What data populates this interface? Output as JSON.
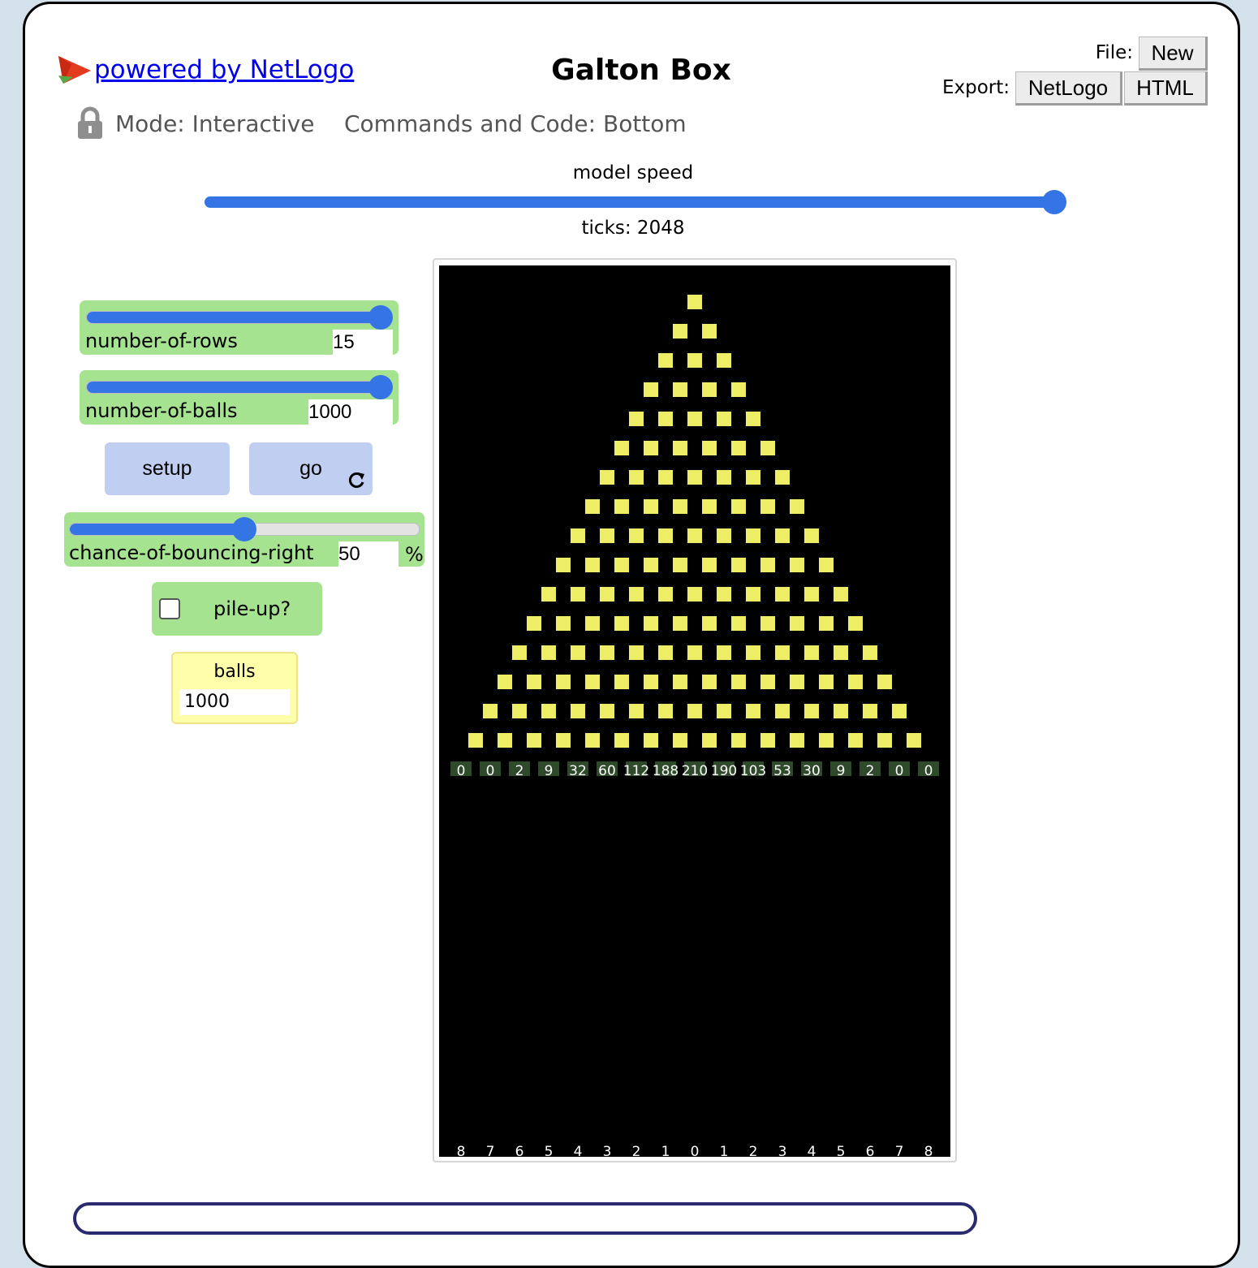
{
  "header": {
    "powered_by": "powered by NetLogo",
    "title": "Galton Box",
    "file_label": "File:",
    "new_label": "New",
    "export_label": "Export:",
    "export_netlogo_label": "NetLogo",
    "export_html_label": "HTML"
  },
  "mode": {
    "lock_icon": "lock-icon",
    "mode_text": "Mode: Interactive",
    "commands_text": "Commands and Code: Bottom"
  },
  "speed": {
    "label": "model speed",
    "value": 1.0,
    "ticks_text": "ticks: 2048"
  },
  "widgets": {
    "rows": {
      "label": "number-of-rows",
      "value": "15",
      "fill": 1.0
    },
    "balls": {
      "label": "number-of-balls",
      "value": "1000",
      "fill": 1.0
    },
    "setup_label": "setup",
    "go_label": "go",
    "go_icon": "forever-icon",
    "bounce": {
      "label": "chance-of-bouncing-right",
      "value": "50",
      "units": "%",
      "fill": 0.5
    },
    "pileup": {
      "label": "pile-up?",
      "checked": false
    },
    "monitor": {
      "label": "balls",
      "value": "1000"
    }
  },
  "view": {
    "peg_rows": 16,
    "peg_color": "#eeee66",
    "bin_counts": [
      "0",
      "0",
      "2",
      "9",
      "32",
      "60",
      "112",
      "188",
      "210",
      "190",
      "103",
      "53",
      "30",
      "9",
      "2",
      "0",
      "0"
    ],
    "bin_labels": [
      "8",
      "7",
      "6",
      "5",
      "4",
      "3",
      "2",
      "1",
      "0",
      "1",
      "2",
      "3",
      "4",
      "5",
      "6",
      "7",
      "8"
    ]
  }
}
